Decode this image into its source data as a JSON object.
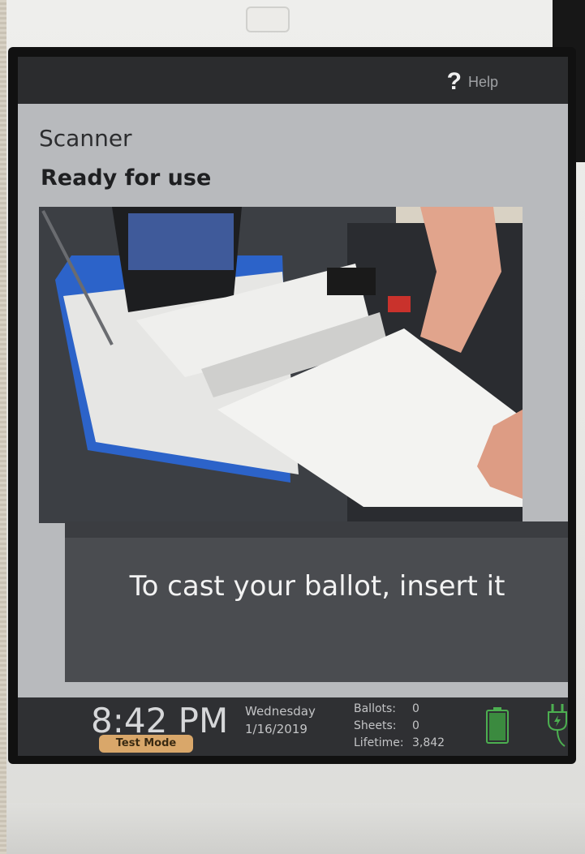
{
  "header": {
    "help_label": "Help",
    "help_icon": "question-mark"
  },
  "page": {
    "device_name": "Scanner",
    "status_text": "Ready for use"
  },
  "main": {
    "instruction": "To cast your ballot, insert it"
  },
  "statusbar": {
    "time": "8:42 PM",
    "mode_badge": "Test Mode",
    "weekday": "Wednesday",
    "date": "1/16/2019",
    "counters": [
      {
        "label": "Ballots:",
        "value": "0"
      },
      {
        "label": "Sheets:",
        "value": "0"
      },
      {
        "label": "Lifetime:",
        "value": "3,842"
      }
    ],
    "battery_icon": "battery-full-icon",
    "power_icon": "power-plug-icon"
  },
  "colors": {
    "topbar": "#2b2c2e",
    "screen_bg": "#b8babd",
    "panel": "#4a4c50",
    "badge": "#d9a76a",
    "indicator_green": "#4caf50"
  }
}
